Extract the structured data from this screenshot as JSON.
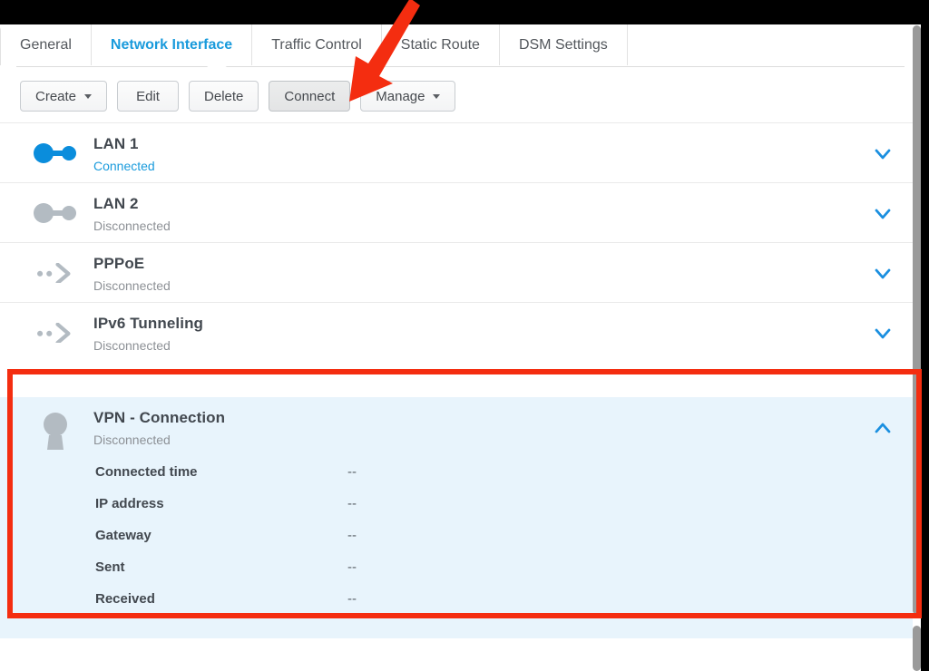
{
  "window": {
    "title_bar_color": "#000000"
  },
  "tabs": [
    {
      "label": "General",
      "active": false
    },
    {
      "label": "Network Interface",
      "active": true
    },
    {
      "label": "Traffic Control",
      "active": false
    },
    {
      "label": "Static Route",
      "active": false
    },
    {
      "label": "DSM Settings",
      "active": false
    }
  ],
  "toolbar": {
    "create_label": "Create",
    "edit_label": "Edit",
    "delete_label": "Delete",
    "connect_label": "Connect",
    "manage_label": "Manage"
  },
  "interfaces": [
    {
      "name": "LAN 1",
      "status": "Connected",
      "status_state": "connected",
      "icon": "link-icon",
      "expanded": false,
      "chevron": "chevron-down-icon"
    },
    {
      "name": "LAN 2",
      "status": "Disconnected",
      "status_state": "disconnected",
      "icon": "link-icon",
      "expanded": false,
      "chevron": "chevron-down-icon"
    },
    {
      "name": "PPPoE",
      "status": "Disconnected",
      "status_state": "disconnected",
      "icon": "dots-arrow-icon",
      "expanded": false,
      "chevron": "chevron-down-icon"
    },
    {
      "name": "IPv6 Tunneling",
      "status": "Disconnected",
      "status_state": "disconnected",
      "icon": "dots-arrow-icon",
      "expanded": false,
      "chevron": "chevron-down-icon"
    },
    {
      "name": "VPN - Connection",
      "status": "Disconnected",
      "status_state": "disconnected",
      "icon": "keyhole-icon",
      "expanded": true,
      "chevron": "chevron-up-icon"
    }
  ],
  "vpn_details": [
    {
      "label": "Connected time",
      "value": "--"
    },
    {
      "label": "IP address",
      "value": "--"
    },
    {
      "label": "Gateway",
      "value": "--"
    },
    {
      "label": "Sent",
      "value": "--"
    },
    {
      "label": "Received",
      "value": "--"
    }
  ],
  "annotations": {
    "highlight_color": "#f42d10",
    "arrow_color": "#f42d10",
    "arrow_target": "Connect"
  },
  "colors": {
    "accent_blue": "#1a9bdc",
    "expanded_row_bg": "#e8f4fc",
    "title_text": "#42484f",
    "muted_text": "#8d9196",
    "icon_gray": "#b3bbc2"
  }
}
